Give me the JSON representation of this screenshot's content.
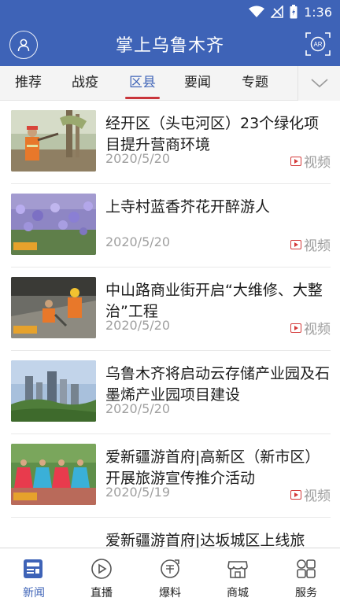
{
  "status_bar": {
    "time": "1:36"
  },
  "header": {
    "title": "掌上乌鲁木齐",
    "ar_label": "AR"
  },
  "tabs": [
    {
      "label": "推荐",
      "active": false
    },
    {
      "label": "战疫",
      "active": false
    },
    {
      "label": "区县",
      "active": true
    },
    {
      "label": "要闻",
      "active": false
    },
    {
      "label": "专题",
      "active": false
    }
  ],
  "news": [
    {
      "title": "经开区（头屯河区）23个绿化项目提升营商环境",
      "date": "2020/5/20",
      "tag": "视频",
      "thumb": "worker-planting-trees"
    },
    {
      "title": "上寺村蓝香芥花开醉游人",
      "date": "2020/5/20",
      "tag": "视频",
      "thumb": "purple-flower-field"
    },
    {
      "title": "中山路商业街开启“大维修、大整治”工程",
      "date": "2020/5/20",
      "tag": "视频",
      "thumb": "construction-workers"
    },
    {
      "title": "乌鲁木齐将启动云存储产业园及石墨烯产业园项目建设",
      "date": "2020/5/20",
      "tag": "",
      "thumb": "city-skyline"
    },
    {
      "title": "爱新疆游首府|高新区（新市区）开展旅游宣传推介活动",
      "date": "2020/5/19",
      "tag": "视频",
      "thumb": "dancers-performance"
    },
    {
      "title": "爱新疆游首府|达坂城区上线旅",
      "date": "",
      "tag": "",
      "thumb": "partial-item"
    }
  ],
  "bottom_nav": [
    {
      "label": "新闻",
      "icon": "news-icon",
      "active": true
    },
    {
      "label": "直播",
      "icon": "play-icon",
      "active": false
    },
    {
      "label": "爆料",
      "icon": "tip-icon",
      "active": false
    },
    {
      "label": "商城",
      "icon": "shop-icon",
      "active": false
    },
    {
      "label": "服务",
      "icon": "services-icon",
      "active": false
    }
  ],
  "colors": {
    "primary": "#3e63b7",
    "accent_red": "#c9353b",
    "date_gray": "#a0a0a0"
  }
}
